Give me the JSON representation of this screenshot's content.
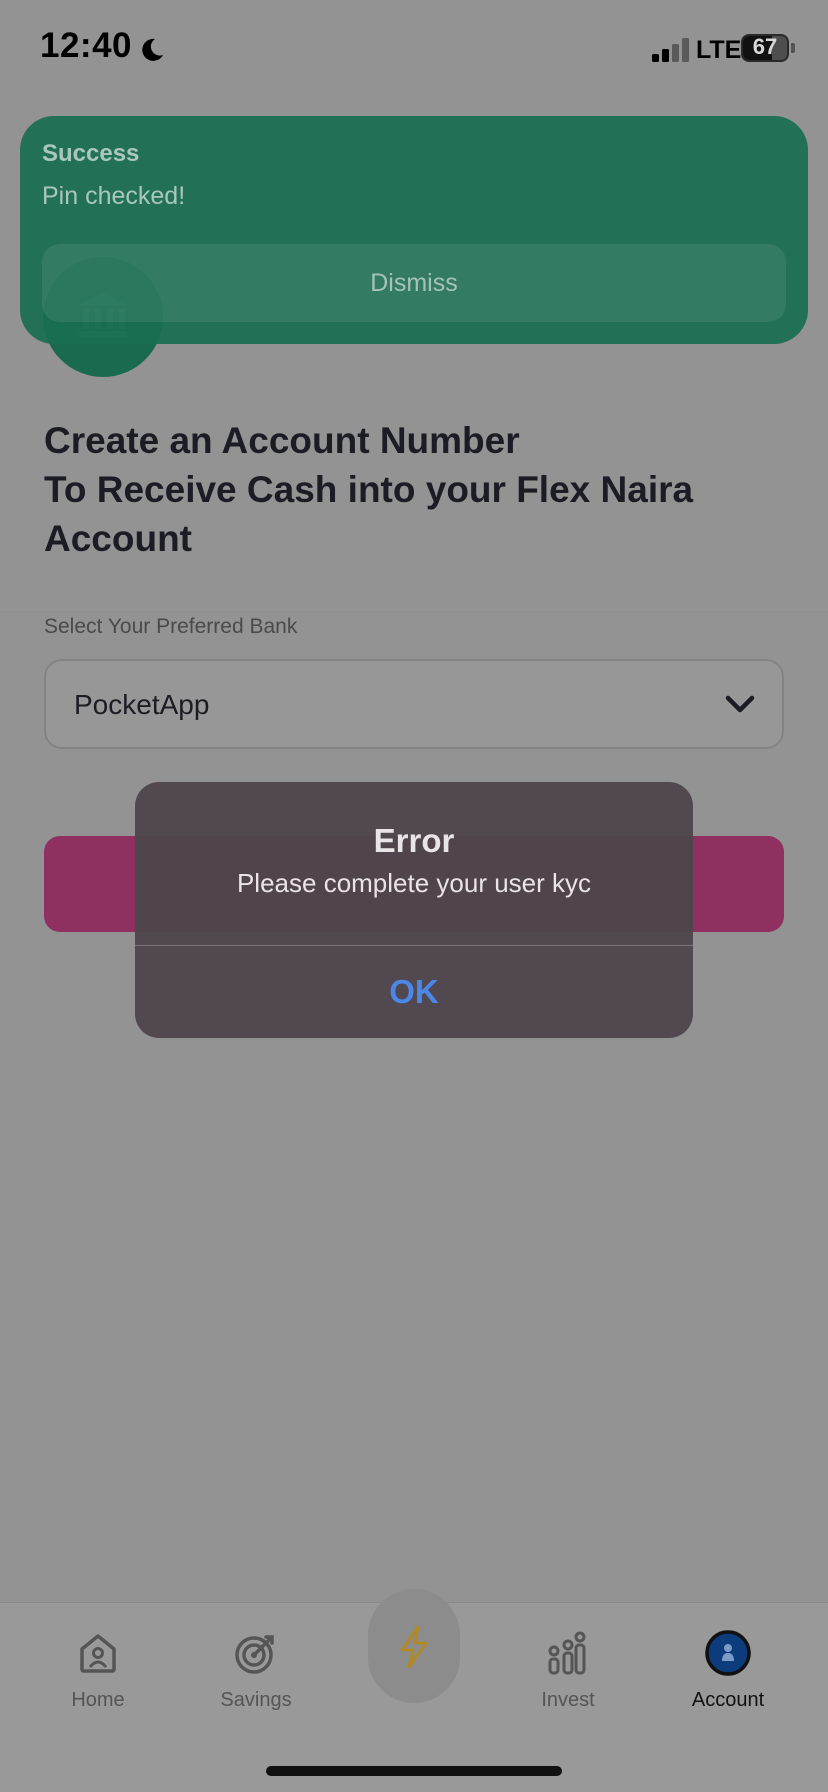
{
  "status_bar": {
    "time": "12:40",
    "network": "LTE",
    "battery": "67",
    "battery_level": 0.67,
    "icons": [
      "moon-icon",
      "signal-icon",
      "battery-icon"
    ]
  },
  "toast": {
    "title": "Success",
    "message": "Pin checked!",
    "dismiss_label": "Dismiss",
    "color": "#1a6e52"
  },
  "page": {
    "headline_lines": [
      "Create an Account Number",
      "To Receive Cash into your Flex Naira",
      "Account"
    ],
    "bank_label": "Select Your Preferred Bank",
    "selected_bank": "PocketApp",
    "accent_color": "#c2185b"
  },
  "alert": {
    "title": "Error",
    "message": "Please complete your user kyc",
    "ok_label": "OK"
  },
  "tab_bar": {
    "tabs": [
      {
        "label": "Home",
        "icon": "home-icon",
        "active": false
      },
      {
        "label": "Savings",
        "icon": "target-icon",
        "active": false
      },
      {
        "label": "",
        "icon": "bolt-icon",
        "active": false
      },
      {
        "label": "Invest",
        "icon": "chart-icon",
        "active": false
      },
      {
        "label": "Account",
        "icon": "account-icon",
        "active": true
      }
    ]
  }
}
